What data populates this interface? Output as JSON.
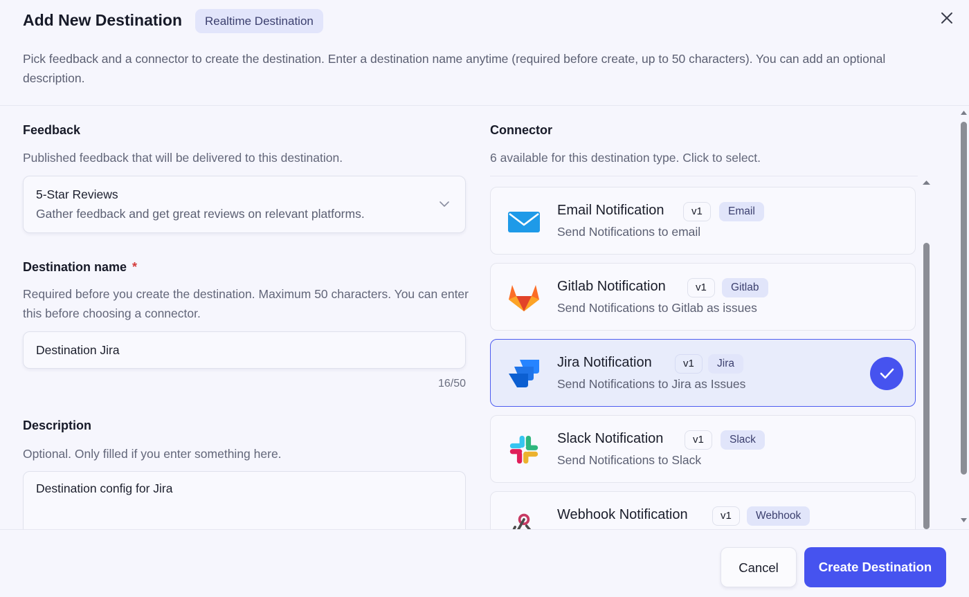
{
  "header": {
    "title": "Add New Destination",
    "badge": "Realtime Destination",
    "subtitle": "Pick feedback and a connector to create the destination. Enter a destination name anytime (required before create, up to 50 characters). You can add an optional description."
  },
  "feedback": {
    "label": "Feedback",
    "help": "Published feedback that will be delivered to this destination.",
    "selected_title": "5-Star Reviews",
    "selected_desc": "Gather feedback and get great reviews on relevant platforms."
  },
  "destination_name": {
    "label": "Destination name",
    "required_mark": "*",
    "help": "Required before you create the destination. Maximum 50 characters. You can enter this before choosing a connector.",
    "value": "Destination Jira",
    "counter": "16/50"
  },
  "description": {
    "label": "Description",
    "help": "Optional. Only filled if you enter something here.",
    "value": "Destination config for Jira"
  },
  "connector": {
    "label": "Connector",
    "help": "6 available for this destination type. Click to select.",
    "items": [
      {
        "name": "Email Notification",
        "version": "v1",
        "tag": "Email",
        "desc": "Send Notifications to email",
        "icon": "envelope-icon",
        "selected": false
      },
      {
        "name": "Gitlab Notification",
        "version": "v1",
        "tag": "Gitlab",
        "desc": "Send Notifications to Gitlab as issues",
        "icon": "gitlab-icon",
        "selected": false
      },
      {
        "name": "Jira Notification",
        "version": "v1",
        "tag": "Jira",
        "desc": "Send Notifications to Jira as Issues",
        "icon": "jira-icon",
        "selected": true
      },
      {
        "name": "Slack Notification",
        "version": "v1",
        "tag": "Slack",
        "desc": "Send Notifications to Slack",
        "icon": "slack-icon",
        "selected": false
      },
      {
        "name": "Webhook Notification",
        "version": "v1",
        "tag": "Webhook",
        "desc": "",
        "icon": "webhook-icon",
        "selected": false
      }
    ]
  },
  "footer": {
    "cancel_label": "Cancel",
    "create_label": "Create Destination"
  },
  "colors": {
    "accent": "#4653ef",
    "required": "#d43b3b",
    "badge_bg": "#e2e5fb"
  }
}
